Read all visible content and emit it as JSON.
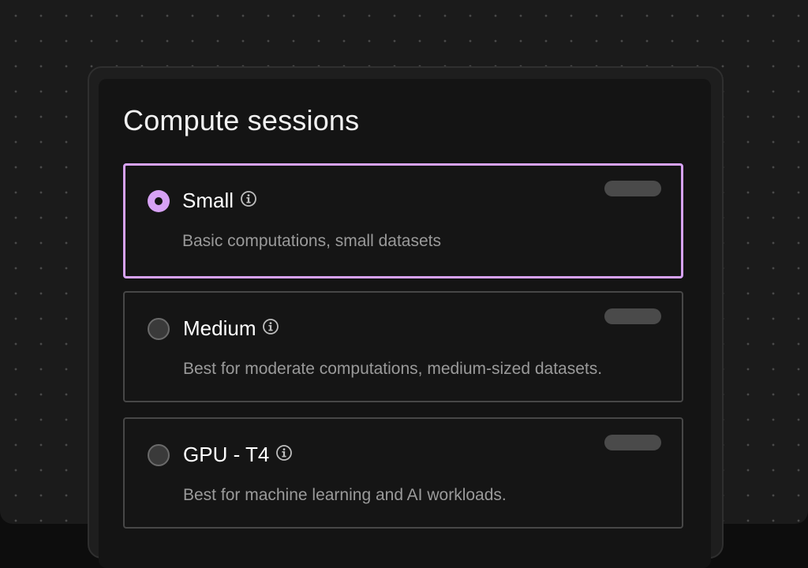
{
  "title": "Compute sessions",
  "colors": {
    "accent": "#d7a2f5",
    "background": "#1b1b1b",
    "panel": "#141414",
    "border": "#474747"
  },
  "options": [
    {
      "name": "Small",
      "description": "Basic computations, small datasets",
      "selected": true,
      "info_icon": "info-icon"
    },
    {
      "name": "Medium",
      "description": "Best for moderate computations, medium-sized datasets.",
      "selected": false,
      "info_icon": "info-icon"
    },
    {
      "name": "GPU - T4",
      "description": "Best for machine learning and AI workloads.",
      "selected": false,
      "info_icon": "info-icon"
    }
  ]
}
